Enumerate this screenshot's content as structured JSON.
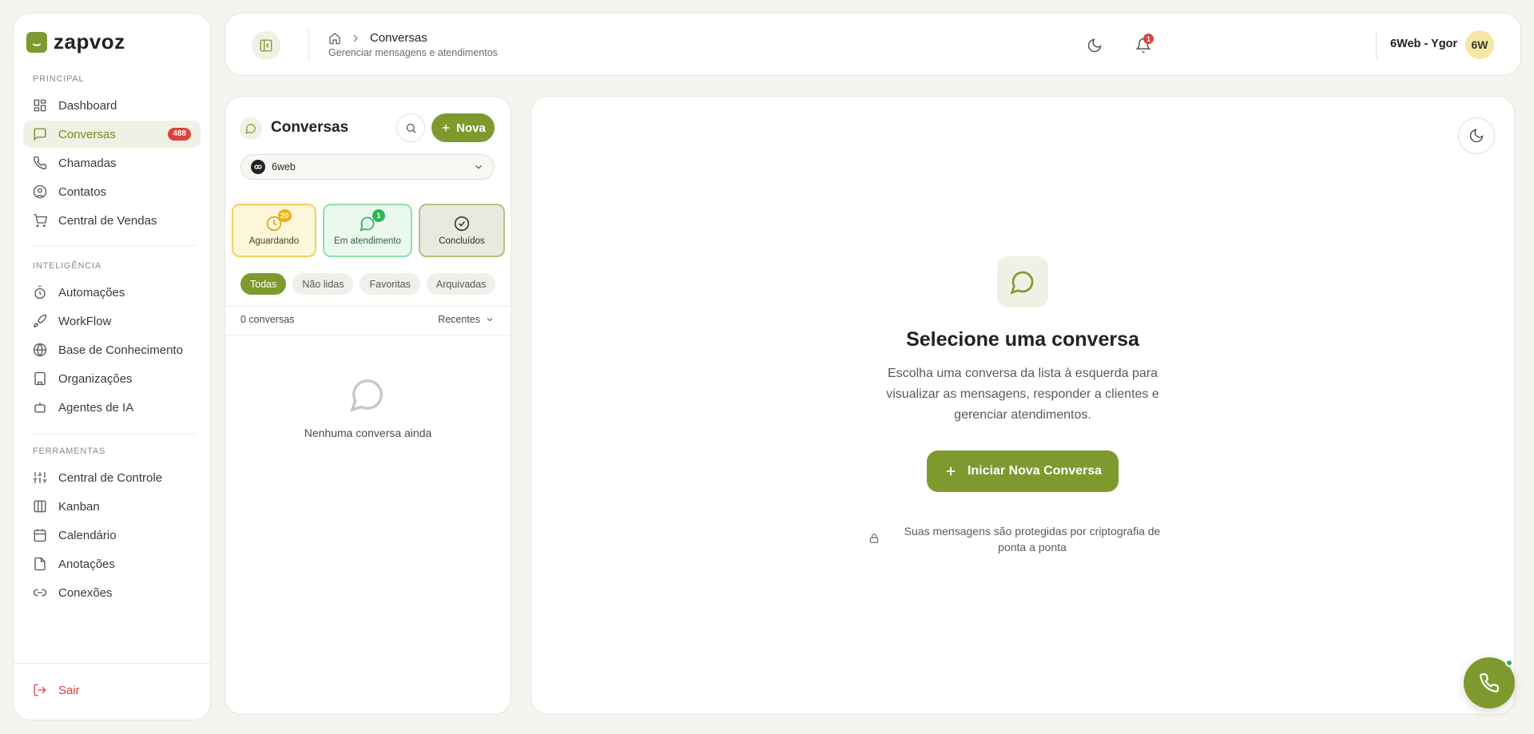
{
  "brand": {
    "name": "zapvoz",
    "accent": "#7e9a2e"
  },
  "sidebar": {
    "sections": [
      {
        "label": "PRINCIPAL",
        "items": [
          {
            "label": "Dashboard",
            "icon": "dashboard-icon"
          },
          {
            "label": "Conversas",
            "icon": "chat-icon",
            "badge": "488",
            "active": true
          },
          {
            "label": "Chamadas",
            "icon": "phone-icon"
          },
          {
            "label": "Contatos",
            "icon": "contacts-icon"
          },
          {
            "label": "Central de Vendas",
            "icon": "cart-icon"
          }
        ]
      },
      {
        "label": "INTELIGÊNCIA",
        "items": [
          {
            "label": "Automações",
            "icon": "timer-icon"
          },
          {
            "label": "WorkFlow",
            "icon": "rocket-icon"
          },
          {
            "label": "Base de Conhecimento",
            "icon": "globe-icon"
          },
          {
            "label": "Organizações",
            "icon": "building-icon"
          },
          {
            "label": "Agentes de IA",
            "icon": "bot-icon"
          }
        ]
      },
      {
        "label": "FERRAMENTAS",
        "items": [
          {
            "label": "Central de Controle",
            "icon": "sliders-icon"
          },
          {
            "label": "Kanban",
            "icon": "kanban-icon"
          },
          {
            "label": "Calendário",
            "icon": "calendar-icon"
          },
          {
            "label": "Anotações",
            "icon": "file-icon"
          },
          {
            "label": "Conexões",
            "icon": "link-icon"
          }
        ]
      }
    ],
    "logout_label": "Sair"
  },
  "header": {
    "breadcrumb": "Conversas",
    "subtitle": "Gerenciar mensagens e atendimentos",
    "notification_count": "1",
    "user_name": "6Web - Ygor",
    "avatar_initials": "6W"
  },
  "list_panel": {
    "title": "Conversas",
    "new_button": "Nova",
    "instance": "6web",
    "status": {
      "waiting": {
        "label": "Aguardando",
        "count": "20"
      },
      "in_service": {
        "label": "Em atendimento",
        "count": "1"
      },
      "done": {
        "label": "Concluídos"
      }
    },
    "filters": [
      "Todas",
      "Não lidas",
      "Favoritas",
      "Arquivadas"
    ],
    "count_label": "0 conversas",
    "sort_label": "Recentes",
    "empty_text": "Nenhuma conversa ainda"
  },
  "main": {
    "title": "Selecione uma conversa",
    "description": "Escolha uma conversa da lista à esquerda para visualizar as mensagens, responder a clientes e gerenciar atendimentos.",
    "start_button": "Iniciar Nova Conversa",
    "secure_note": "Suas mensagens são protegidas por criptografia de ponta a ponta"
  }
}
